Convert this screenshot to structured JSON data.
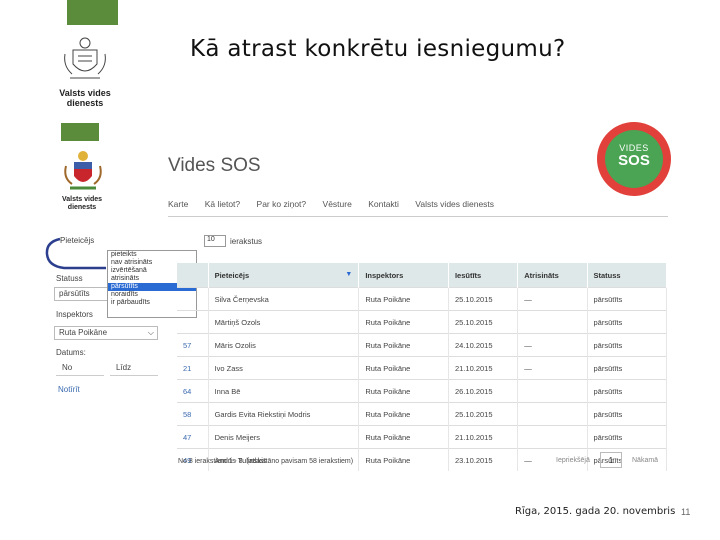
{
  "slide": {
    "title": "Kā atrast konkrētu iesniegumu?",
    "footer": "Rīga, 2015. gada 20. novembris",
    "page_number": "11"
  },
  "logos": {
    "top_line1": "Valsts vides",
    "top_line2": "dienests",
    "bottom_line1": "Valsts vides",
    "bottom_line2": "dienests"
  },
  "app": {
    "title": "Vides SOS",
    "badge_line1": "VIDES",
    "badge_line2": "SOS",
    "nav": [
      "Karte",
      "Kā lietot?",
      "Par ko ziņot?",
      "Vēsture",
      "Kontakti",
      "Valsts vides dienests"
    ]
  },
  "filters": {
    "pieteicejs_label": "Pieteicējs",
    "per_page_value": "10",
    "per_page_suffix": "ierakstus",
    "status_label": "Statuss",
    "status_value": "pārsūtīts",
    "status_options": [
      "pieteikts",
      "nav atrisināts",
      "izvērtēšanā",
      "atrisināts",
      "pārsūtīts",
      "noraidīts",
      "ir pārbaudīts"
    ],
    "status_selected_index": 4,
    "inspector_label": "Inspektors",
    "inspector_value": "Ruta Poikāne",
    "date_label": "Datums:",
    "date_from": "No",
    "date_to": "Līdz",
    "clear_link": "Notīrīt"
  },
  "table": {
    "headers": [
      "Pieteicējs",
      "Inspektors",
      "Iesūtīts",
      "Atrisināts",
      "Statuss"
    ],
    "rows": [
      {
        "id": "",
        "applicant": "Silva Čerņevska",
        "inspector": "Ruta Poikāne",
        "submitted": "25.10.2015",
        "solved": "—",
        "status": "pārsūtīts"
      },
      {
        "id": "",
        "applicant": "Mārtiņš Ozols",
        "inspector": "Ruta Poikāne",
        "submitted": "25.10.2015",
        "solved": "",
        "status": "pārsūtīts"
      },
      {
        "id": "57",
        "applicant": "Māris Ozolis",
        "inspector": "Ruta Poikāne",
        "submitted": "24.10.2015",
        "solved": "—",
        "status": "pārsūtīts"
      },
      {
        "id": "21",
        "applicant": "Ivo Zass",
        "inspector": "Ruta Poikāne",
        "submitted": "21.10.2015",
        "solved": "—",
        "status": "pārsūtīts"
      },
      {
        "id": "64",
        "applicant": "Inna Bē",
        "inspector": "Ruta Poikāne",
        "submitted": "26.10.2015",
        "solved": "",
        "status": "pārsūtīts"
      },
      {
        "id": "58",
        "applicant": "Gardis Evita Riekstiņi Modris",
        "inspector": "Ruta Poikāne",
        "submitted": "25.10.2015",
        "solved": "",
        "status": "pārsūtīts"
      },
      {
        "id": "47",
        "applicant": "Denis Meijers",
        "inspector": "Ruta Poikāne",
        "submitted": "21.10.2015",
        "solved": "",
        "status": "pārsūtīts"
      },
      {
        "id": "49",
        "applicant": "Andris Tulinskis",
        "inspector": "Ruta Poikāne",
        "submitted": "23.10.2015",
        "solved": "—",
        "status": "pārsūtīts"
      }
    ],
    "footer_info": "No 8 ierakstiem 1 - 8. (atlasītāno pavisam 58 ierakstiem)",
    "pager_prev": "Iepriekšējā",
    "pager_page": "1",
    "pager_next": "Nākamā"
  },
  "colors": {
    "green_block": "#5b8c3b",
    "badge_red": "#e2403a",
    "badge_green": "#4aa454",
    "table_header": "#dfe8e8",
    "dropdown_highlight": "#2a6ad3"
  }
}
